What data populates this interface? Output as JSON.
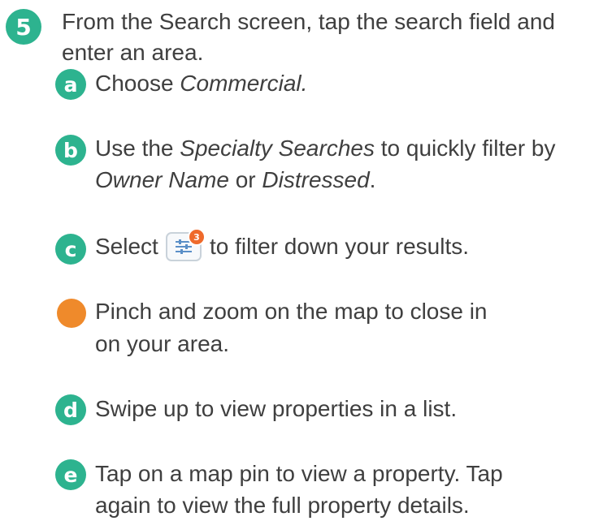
{
  "step": {
    "number": "5",
    "line1": "From the Search screen, tap the search field and",
    "line2": "enter an area."
  },
  "items": [
    {
      "badge": "a",
      "lines": [
        {
          "pre": "Choose ",
          "em": "Commercial.",
          "post": ""
        }
      ]
    },
    {
      "badge": "b",
      "lines": [
        {
          "pre": "Use the ",
          "em": "Specialty Searches",
          "post": " to quickly filter by"
        },
        {
          "pre": "",
          "em": "Owner Name",
          "post": " or ",
          "em2": "Distressed",
          "post2": "."
        }
      ]
    },
    {
      "badge": "c",
      "pre": "Select",
      "post": "to filter down your results.",
      "icon": "filter-settings-icon",
      "icon_count": "3"
    },
    {
      "badge": "",
      "badge_color": "#ef8a2b",
      "line1": "Pinch and zoom on the map to close in",
      "line2": "on your area."
    },
    {
      "badge": "d",
      "line1": "Swipe up to view properties in a list."
    },
    {
      "badge": "e",
      "line1": "Tap on a map pin to view a property. Tap",
      "line2": "again to view the full property details."
    }
  ],
  "colors": {
    "badge_green": "#2db38f",
    "badge_orange": "#ef8a2b",
    "text": "#3f3f3f"
  }
}
